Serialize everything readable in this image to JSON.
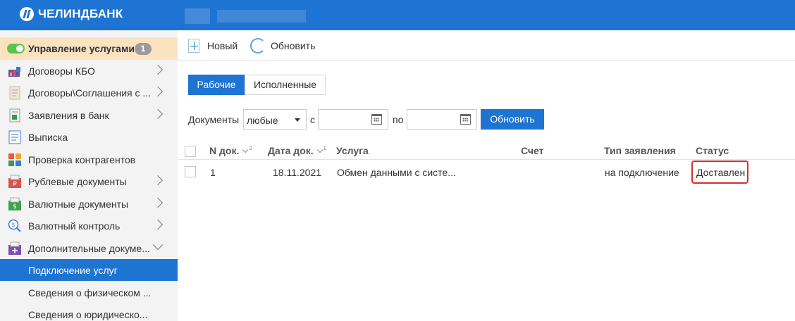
{
  "header": {
    "bank_name": "ЧЕЛИНДБАНК"
  },
  "sidebar": {
    "service_mgmt": {
      "label": "Управление услугами",
      "count": "1"
    },
    "items": [
      {
        "label": "Договоры КБО",
        "icon": "contracts-icon",
        "has_arrow": true
      },
      {
        "label": "Договоры\\Соглашения с ...",
        "icon": "agreements-icon",
        "has_arrow": true
      },
      {
        "label": "Заявления в банк",
        "icon": "applications-icon",
        "has_arrow": true
      },
      {
        "label": "Выписка",
        "icon": "statement-icon",
        "has_arrow": false
      },
      {
        "label": "Проверка контрагентов",
        "icon": "counterparty-check-icon",
        "has_arrow": false
      },
      {
        "label": "Рублевые документы",
        "icon": "ruble-docs-icon",
        "has_arrow": true
      },
      {
        "label": "Валютные документы",
        "icon": "currency-docs-icon",
        "has_arrow": true
      },
      {
        "label": "Валютный контроль",
        "icon": "currency-control-icon",
        "has_arrow": true
      },
      {
        "label": "Дополнительные докуме...",
        "icon": "additional-docs-icon",
        "has_arrow": true,
        "expanded": true
      }
    ],
    "subitems": [
      {
        "label": "Подключение услуг",
        "active": true
      },
      {
        "label": "Сведения о физическом ..."
      },
      {
        "label": "Сведения о юридическо..."
      }
    ]
  },
  "toolbar": {
    "new_label": "Новый",
    "refresh_label": "Обновить"
  },
  "tabs": [
    {
      "label": "Рабочие",
      "active": true
    },
    {
      "label": "Исполненные",
      "active": false
    }
  ],
  "filter": {
    "docs_label": "Документы",
    "docs_value": "любые",
    "from_label": "с",
    "to_label": "по",
    "from_value": "",
    "to_value": "",
    "refresh_button": "Обновить"
  },
  "table": {
    "columns": {
      "num": "N док.",
      "num_sort": "2",
      "date": "Дата док.",
      "date_sort": "1",
      "service": "Услуга",
      "account": "Счет",
      "type": "Тип заявления",
      "status": "Статус"
    },
    "rows": [
      {
        "num": "1",
        "date": "18.11.2021",
        "service": "Обмен данными с систе...",
        "account": "",
        "type": "на подключение",
        "status": "Доставлен"
      }
    ]
  },
  "colors": {
    "primary": "#1e74d2",
    "highlight": "#fbe3c0",
    "status_border": "#d4312d",
    "toggle_on": "#5ac54c"
  }
}
